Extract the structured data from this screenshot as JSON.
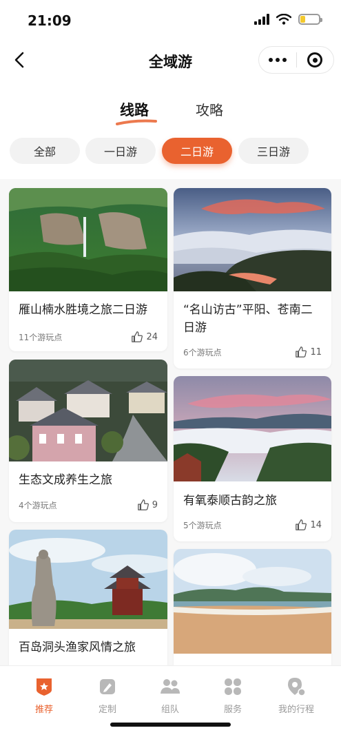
{
  "status_bar": {
    "time": "21:09"
  },
  "nav": {
    "title": "全域游"
  },
  "top_tabs": [
    {
      "label": "线路",
      "active": true
    },
    {
      "label": "攻略",
      "active": false
    }
  ],
  "filters": [
    {
      "label": "全部",
      "active": false
    },
    {
      "label": "一日游",
      "active": false
    },
    {
      "label": "二日游",
      "active": true
    },
    {
      "label": "三日游",
      "active": false
    }
  ],
  "cards_left": [
    {
      "title": "雁山楠水胜境之旅二日游",
      "spots": "11个游玩点",
      "likes": "24",
      "image": "waterfall-canyon"
    },
    {
      "title": "生态文成养生之旅",
      "spots": "4个游玩点",
      "likes": "9",
      "image": "village-houses"
    },
    {
      "title": "百岛洞头渔家风情之旅",
      "image": "statue-pagoda"
    }
  ],
  "cards_right": [
    {
      "title": "“名山访古”平阳、苍南二日游",
      "spots": "6个游玩点",
      "likes": "11",
      "image": "sea-of-clouds"
    },
    {
      "title": "有氧泰顺古韵之旅",
      "spots": "5个游玩点",
      "likes": "14",
      "image": "misty-valley"
    },
    {
      "title": "",
      "image": "beach"
    }
  ],
  "tab_bar": [
    {
      "label": "推荐",
      "icon": "star-shield-icon",
      "active": true
    },
    {
      "label": "定制",
      "icon": "edit-icon",
      "active": false
    },
    {
      "label": "组队",
      "icon": "group-icon",
      "active": false
    },
    {
      "label": "服务",
      "icon": "grid-icon",
      "active": false
    },
    {
      "label": "我的行程",
      "icon": "location-icon",
      "active": false
    }
  ],
  "colors": {
    "accent": "#e9622f",
    "background": "#f7f7f7",
    "inactive": "#9a9a9a"
  }
}
